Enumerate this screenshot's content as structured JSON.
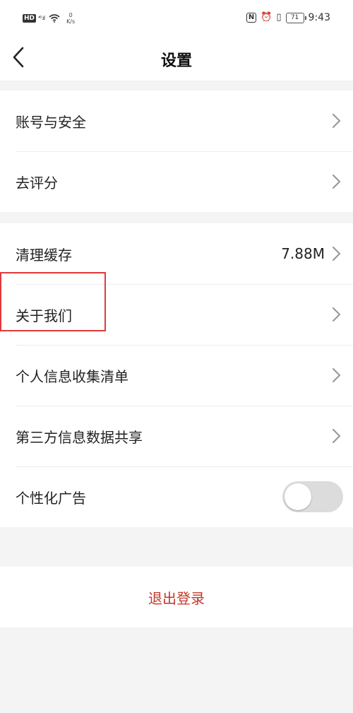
{
  "status_bar": {
    "hd": "HD",
    "signal": "⁴ᴳ.ıl",
    "net_speed_value": "0",
    "net_speed_unit": "K/s",
    "nfc": "N",
    "alarm": "⏰",
    "vibrate": "▯",
    "battery": "71",
    "time": "9:43"
  },
  "nav": {
    "title": "设置"
  },
  "groups": [
    {
      "rows": [
        {
          "label": "账号与安全"
        },
        {
          "label": "去评分"
        }
      ]
    },
    {
      "rows": [
        {
          "label": "清理缓存",
          "value": "7.88M"
        },
        {
          "label": "关于我们"
        },
        {
          "label": "个人信息收集清单"
        },
        {
          "label": "第三方信息数据共享"
        },
        {
          "label": "个性化广告",
          "toggle_on": false
        }
      ]
    }
  ],
  "logout": {
    "label": "退出登录",
    "color": "#c0392b"
  },
  "highlight": {
    "color": "#e03a3a",
    "target": "关于我们"
  }
}
